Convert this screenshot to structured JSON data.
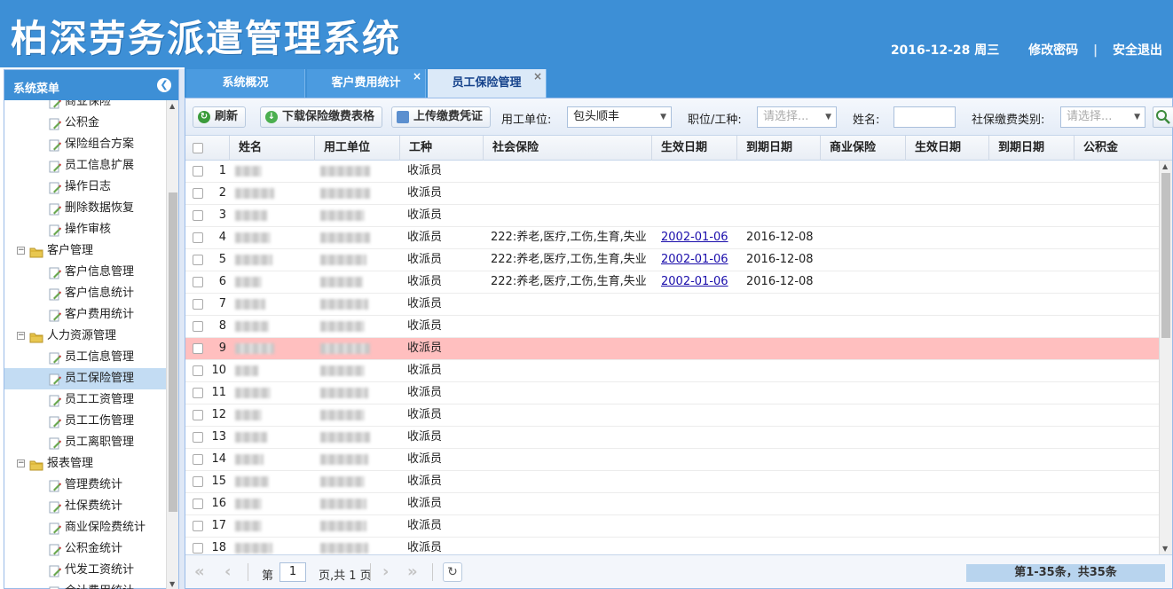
{
  "header": {
    "title": "柏深劳务派遣管理系统",
    "date": "2016-12-28 周三",
    "change_password": "修改密码",
    "separator": "|",
    "logout": "安全退出"
  },
  "sidebar": {
    "title": "系统菜单",
    "items": [
      {
        "label": "商业保险",
        "type": "leaf"
      },
      {
        "label": "公积金",
        "type": "leaf"
      },
      {
        "label": "保险组合方案",
        "type": "leaf"
      },
      {
        "label": "员工信息扩展",
        "type": "leaf"
      },
      {
        "label": "操作日志",
        "type": "leaf"
      },
      {
        "label": "删除数据恢复",
        "type": "leaf"
      },
      {
        "label": "操作审核",
        "type": "leaf"
      },
      {
        "label": "客户管理",
        "type": "group"
      },
      {
        "label": "客户信息管理",
        "type": "leaf"
      },
      {
        "label": "客户信息统计",
        "type": "leaf"
      },
      {
        "label": "客户费用统计",
        "type": "leaf"
      },
      {
        "label": "人力资源管理",
        "type": "group"
      },
      {
        "label": "员工信息管理",
        "type": "leaf"
      },
      {
        "label": "员工保险管理",
        "type": "leaf",
        "selected": true
      },
      {
        "label": "员工工资管理",
        "type": "leaf"
      },
      {
        "label": "员工工伤管理",
        "type": "leaf"
      },
      {
        "label": "员工离职管理",
        "type": "leaf"
      },
      {
        "label": "报表管理",
        "type": "group"
      },
      {
        "label": "管理费统计",
        "type": "leaf"
      },
      {
        "label": "社保费统计",
        "type": "leaf"
      },
      {
        "label": "商业保险费统计",
        "type": "leaf"
      },
      {
        "label": "公积金统计",
        "type": "leaf"
      },
      {
        "label": "代发工资统计",
        "type": "leaf"
      },
      {
        "label": "合计费用统计",
        "type": "leaf"
      }
    ]
  },
  "tabs": [
    {
      "label": "系统概况",
      "closable": false,
      "active": false
    },
    {
      "label": "客户费用统计",
      "closable": true,
      "active": false
    },
    {
      "label": "员工保险管理",
      "closable": true,
      "active": true
    }
  ],
  "toolbar": {
    "refresh": "刷新",
    "download": "下载保险缴费表格",
    "upload": "上传缴费凭证",
    "employer_label": "用工单位:",
    "employer_value": "包头顺丰",
    "position_label": "职位/工种:",
    "position_placeholder": "请选择...",
    "name_label": "姓名:",
    "name_value": "",
    "category_label": "社保缴费类别:",
    "category_placeholder": "请选择..."
  },
  "grid": {
    "columns": [
      "姓名",
      "用工单位",
      "工种",
      "社会保险",
      "生效日期",
      "到期日期",
      "商业保险",
      "生效日期",
      "到期日期",
      "公积金"
    ],
    "rows": [
      {
        "no": "1",
        "job": "收派员",
        "social": "",
        "start": "",
        "end": ""
      },
      {
        "no": "2",
        "job": "收派员",
        "social": "",
        "start": "",
        "end": ""
      },
      {
        "no": "3",
        "job": "收派员",
        "social": "",
        "start": "",
        "end": ""
      },
      {
        "no": "4",
        "job": "收派员",
        "social": "222:养老,医疗,工伤,生育,失业",
        "start": "2002-01-06",
        "end": "2016-12-08"
      },
      {
        "no": "5",
        "job": "收派员",
        "social": "222:养老,医疗,工伤,生育,失业",
        "start": "2002-01-06",
        "end": "2016-12-08"
      },
      {
        "no": "6",
        "job": "收派员",
        "social": "222:养老,医疗,工伤,生育,失业",
        "start": "2002-01-06",
        "end": "2016-12-08"
      },
      {
        "no": "7",
        "job": "收派员",
        "social": "",
        "start": "",
        "end": ""
      },
      {
        "no": "8",
        "job": "收派员",
        "social": "",
        "start": "",
        "end": ""
      },
      {
        "no": "9",
        "job": "收派员",
        "social": "",
        "start": "",
        "end": "",
        "highlight": true
      },
      {
        "no": "10",
        "job": "收派员",
        "social": "",
        "start": "",
        "end": ""
      },
      {
        "no": "11",
        "job": "收派员",
        "social": "",
        "start": "",
        "end": ""
      },
      {
        "no": "12",
        "job": "收派员",
        "social": "",
        "start": "",
        "end": ""
      },
      {
        "no": "13",
        "job": "收派员",
        "social": "",
        "start": "",
        "end": ""
      },
      {
        "no": "14",
        "job": "收派员",
        "social": "",
        "start": "",
        "end": ""
      },
      {
        "no": "15",
        "job": "收派员",
        "social": "",
        "start": "",
        "end": ""
      },
      {
        "no": "16",
        "job": "收派员",
        "social": "",
        "start": "",
        "end": ""
      },
      {
        "no": "17",
        "job": "收派员",
        "social": "",
        "start": "",
        "end": ""
      },
      {
        "no": "18",
        "job": "收派员",
        "social": "",
        "start": "",
        "end": ""
      }
    ]
  },
  "pager": {
    "page_prefix": "第",
    "page_value": "1",
    "page_suffix": "页,共 1 页",
    "info": "第1-35条，共35条"
  },
  "colors": {
    "brand": "#3d8fd6",
    "highlight_row": "#ffbfbf",
    "selected_menu": "#c3dcf3"
  }
}
